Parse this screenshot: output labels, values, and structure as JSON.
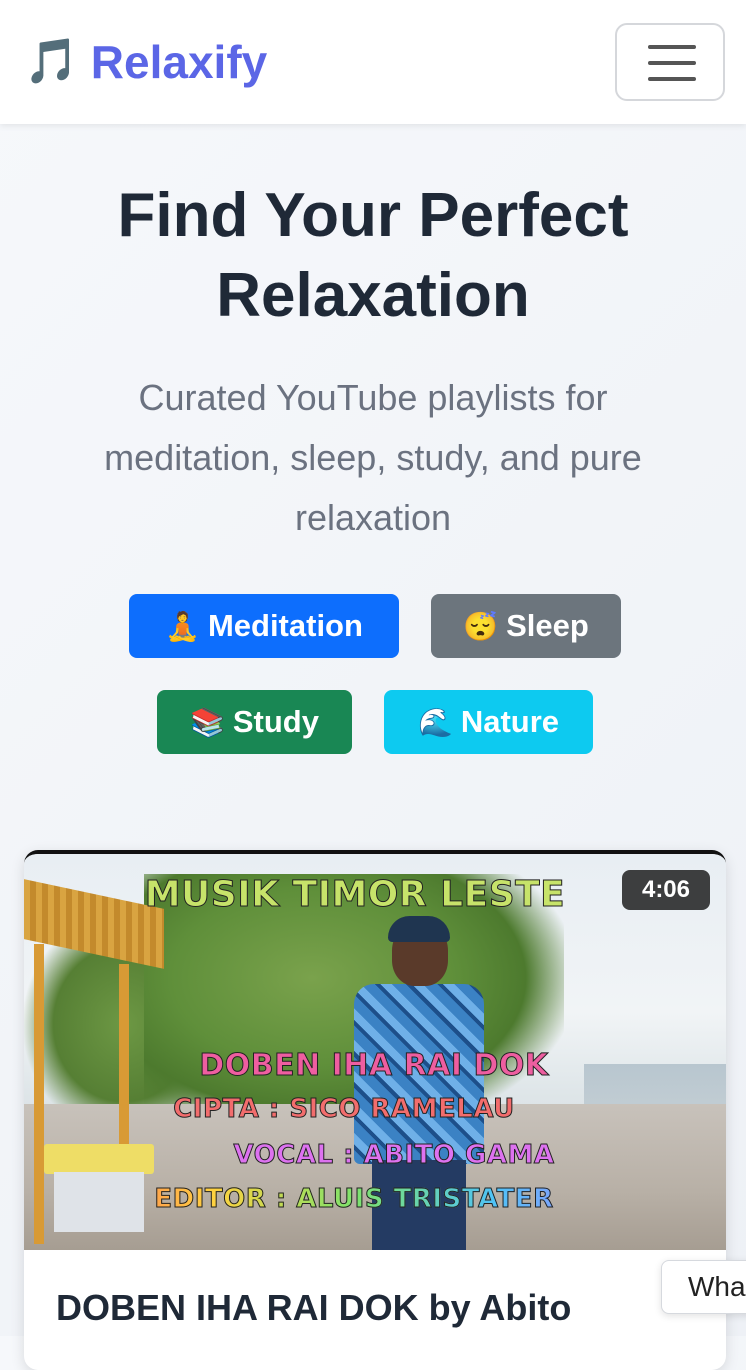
{
  "app": {
    "brand_icon": "🎵",
    "brand_icon_name": "music-notes-icon",
    "brand_name": "Relaxify",
    "brand_color": "#5b66e6",
    "menu_icon_name": "hamburger-menu-icon"
  },
  "hero": {
    "title": "Find Your Perfect Relaxation",
    "subtitle": "Curated YouTube playlists for meditation, sleep, study, and pure relaxation"
  },
  "categories": [
    {
      "emoji": "🧘",
      "label": "Meditation",
      "color": "#0d6efd"
    },
    {
      "emoji": "😴",
      "label": "Sleep",
      "color": "#6c757d"
    },
    {
      "emoji": "📚",
      "label": "Study",
      "color": "#198754"
    },
    {
      "emoji": "🌊",
      "label": "Nature",
      "color": "#0dcaf0"
    }
  ],
  "video_card": {
    "duration": "4:06",
    "thumbnail_text": {
      "headline": "MUSIK TIMOR LESTE",
      "song": "DOBEN IHA RAI DOK",
      "cipta": "CIPTA : SICO RAMELAU",
      "vocal": "VOCAL : ABITO GAMA",
      "editor": "EDITOR : ALUIS TRISTATER"
    },
    "title": "DOBEN IHA RAI DOK by Abito"
  },
  "floating_widget": {
    "label": "Wha"
  }
}
